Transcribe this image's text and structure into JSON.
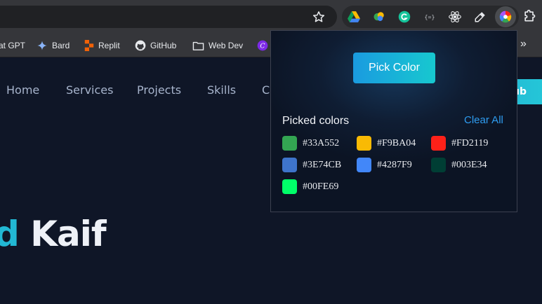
{
  "browser": {
    "bookmarks": [
      {
        "label": "at GPT",
        "icon": "chatgpt-icon"
      },
      {
        "label": "Bard",
        "icon": "bard-sparkle-icon"
      },
      {
        "label": "Replit",
        "icon": "replit-icon"
      },
      {
        "label": "GitHub",
        "icon": "github-icon"
      },
      {
        "label": "Web Dev",
        "icon": "folder-icon"
      }
    ],
    "extensions": [
      "google-drive-icon",
      "color-drop-icon",
      "grammarly-icon",
      "json-viewer-icon",
      "react-devtools-icon",
      "eyedropper-icon",
      "color-picker-extension-icon"
    ]
  },
  "website": {
    "nav": [
      "Home",
      "Services",
      "Projects",
      "Skills",
      "Co"
    ],
    "github_button": "ub",
    "hero_accent": "d",
    "hero_main": "Kaif",
    "accent_color": "#22b8d4"
  },
  "popup": {
    "pick_button": "Pick Color",
    "picked_title": "Picked colors",
    "clear_all": "Clear All",
    "colors": [
      {
        "hex": "#33A552"
      },
      {
        "hex": "#F9BA04"
      },
      {
        "hex": "#FD2119"
      },
      {
        "hex": "#3E74CB"
      },
      {
        "hex": "#4287F9"
      },
      {
        "hex": "#003E34"
      },
      {
        "hex": "#00FE69"
      }
    ]
  }
}
